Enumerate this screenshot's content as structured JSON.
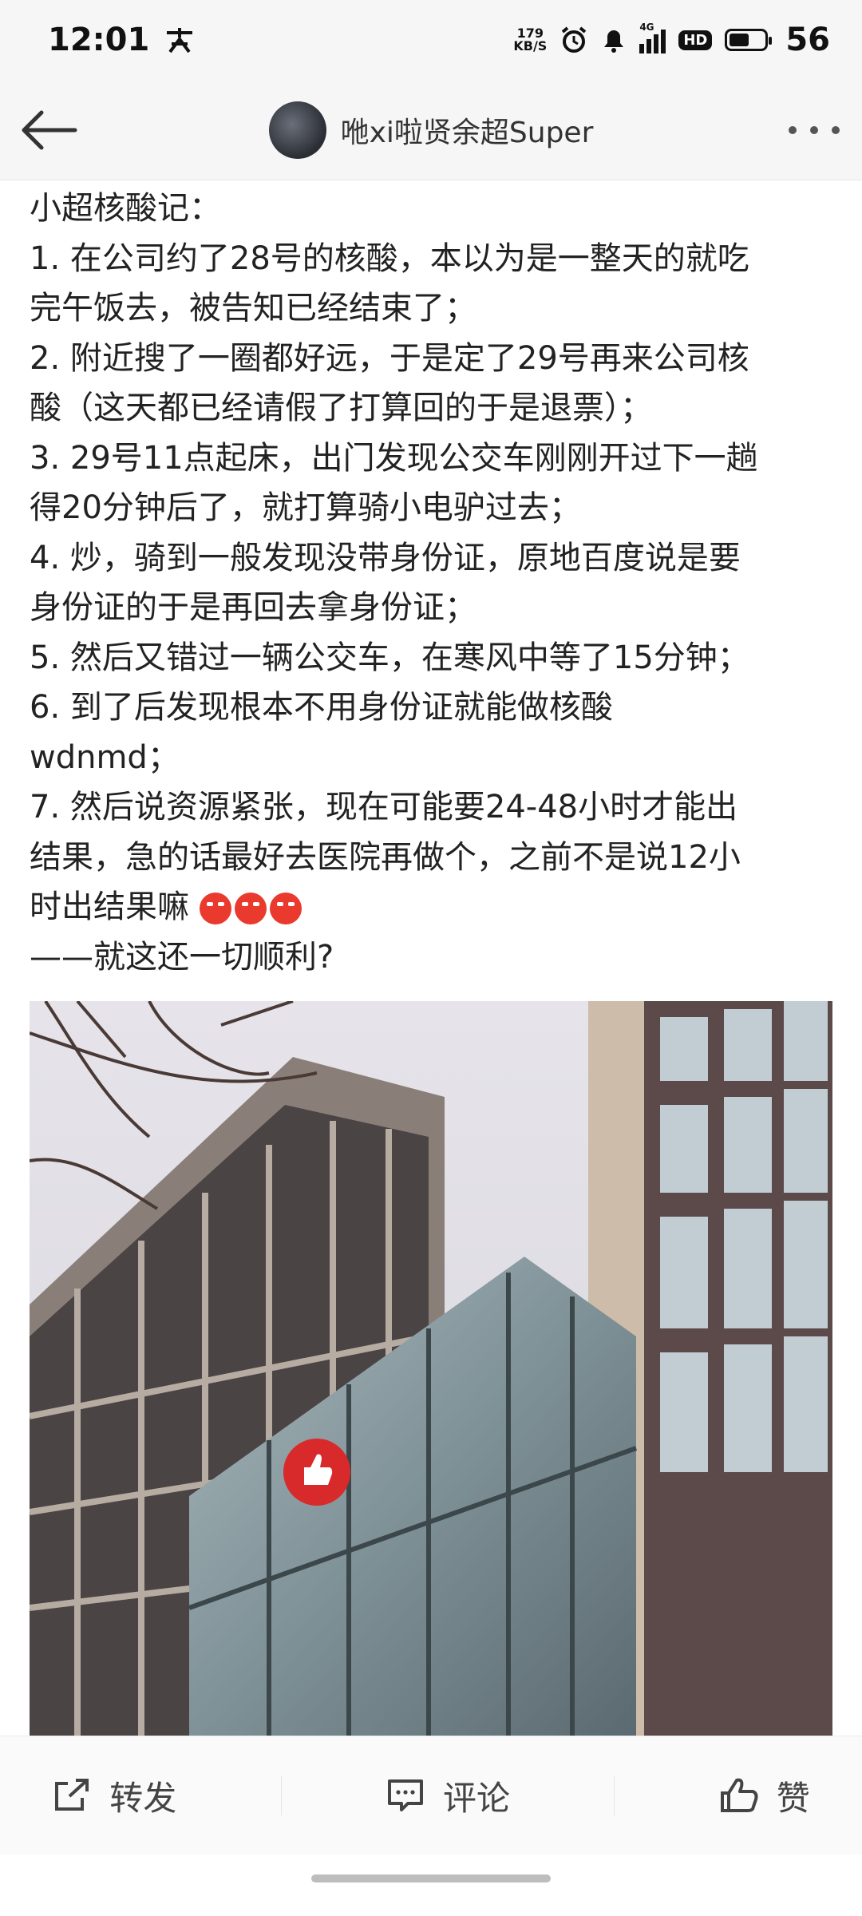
{
  "status_bar": {
    "time": "12:01",
    "net_speed_value": "179",
    "net_speed_unit": "KB/S",
    "signal_label": "4G",
    "hd_label": "HD",
    "battery_level": "56",
    "battery_fraction": 0.56
  },
  "header": {
    "title": "咃xi啦贤余超Super"
  },
  "post": {
    "lines": [
      "小超核酸记：",
      "1. 在公司约了28号的核酸，本以为是一整天的就吃",
      "完午饭去，被告知已经结束了；",
      "2. 附近搜了一圈都好远，于是定了29号再来公司核",
      "酸（这天都已经请假了打算回的于是退票）；",
      "3. 29号11点起床，出门发现公交车刚刚开过下一趟",
      "得20分钟后了，就打算骑小电驴过去；",
      "4. 炒，骑到一般发现没带身份证，原地百度说是要",
      "身份证的于是再回去拿身份证；",
      "5. 然后又错过一辆公交车，在寒风中等了15分钟；",
      "6. 到了后发现根本不用身份证就能做核酸",
      "wdnmd；",
      "7. 然后说资源紧张，现在可能要24-48小时才能出",
      "结果，急的话最好去医院再做个，之前不是说12小",
      "时出结果嘛",
      "——就这还一切顺利?"
    ]
  },
  "actions": {
    "repost_label": "转发",
    "comment_label": "评论",
    "like_label": "赞"
  },
  "colors": {
    "accent_red": "#ea3a2d",
    "status_bg": "#f6f6f6"
  }
}
